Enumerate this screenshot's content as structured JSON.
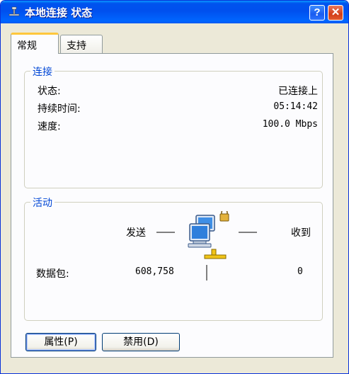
{
  "window": {
    "title": "本地连接 状态",
    "help_label": "?",
    "close_label": "✕"
  },
  "tabs": [
    {
      "label": "常规",
      "active": true
    },
    {
      "label": "支持",
      "active": false
    }
  ],
  "connection": {
    "legend": "连接",
    "rows": [
      {
        "label": "状态:",
        "value": "已连接上"
      },
      {
        "label": "持续时间:",
        "value": "05:14:42"
      },
      {
        "label": "速度:",
        "value": "100.0 Mbps"
      }
    ]
  },
  "activity": {
    "legend": "活动",
    "sent_label": "发送",
    "received_label": "收到",
    "packets_label": "数据包:",
    "sent_value": "608,758",
    "received_value": "0"
  },
  "buttons": {
    "properties": "属性(P)",
    "disable": "禁用(D)"
  },
  "colors": {
    "title_bar": "#0054e3",
    "legend_text": "#0046d5",
    "tab_highlight": "#ffc73c",
    "close_button": "#d33d18"
  },
  "icons": {
    "title": "network-connection-icon",
    "activity": "network-computers-icon"
  }
}
